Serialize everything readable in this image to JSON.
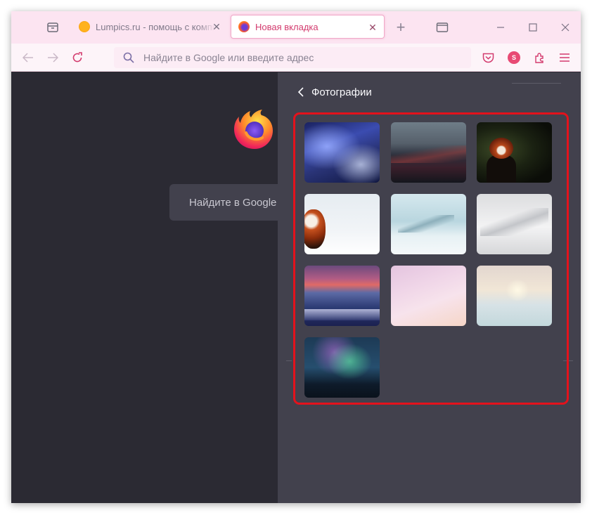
{
  "tabs": [
    {
      "title": "Lumpics.ru - помощь с компьютером",
      "active": false,
      "favicon": "lumpics-favicon"
    },
    {
      "title": "Новая вкладка",
      "active": true,
      "favicon": "firefox-favicon"
    }
  ],
  "urlbar": {
    "placeholder": "Найдите в Google или введите адрес"
  },
  "account_initial": "S",
  "newtab": {
    "search_placeholder": "Найдите в Google или введите адрес"
  },
  "panel": {
    "title": "Фотографии",
    "photos": [
      {
        "name": "blue-clouds"
      },
      {
        "name": "mountains-dusk"
      },
      {
        "name": "red-panda-dark"
      },
      {
        "name": "red-panda-snow"
      },
      {
        "name": "misty-mountains"
      },
      {
        "name": "snowy-hills"
      },
      {
        "name": "sunset-ocean"
      },
      {
        "name": "pink-clouds"
      },
      {
        "name": "beach-sunrise"
      },
      {
        "name": "aurora"
      }
    ]
  },
  "colors": {
    "accent": "#d33b6e",
    "highlight": "#e3121c",
    "tabstrip": "#fce4f1",
    "content_bg": "#2b2a33",
    "panel_bg": "#42414d"
  }
}
